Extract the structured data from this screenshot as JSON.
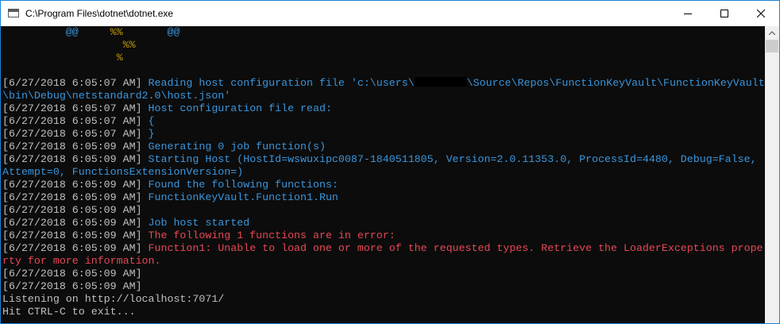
{
  "window": {
    "title": "C:\\Program Files\\dotnet\\dotnet.exe",
    "accent": "#1883d7"
  },
  "colors": {
    "background": "#0c0c0c",
    "default_text": "#c0c0c0",
    "info": "#3a96dd",
    "ascii_art": "#c19c00",
    "error": "#e74856"
  },
  "console": {
    "ascii": [
      {
        "left": "          ",
        "left_mark": "@@",
        "mid_gap": "     ",
        "mid_mark": "%%",
        "right_gap": "       ",
        "right_mark": "@@"
      },
      {
        "mid_pad": "                   ",
        "mid_mark": "%%"
      },
      {
        "mid_pad": "                  ",
        "mid_mark": "%"
      }
    ],
    "lines": [
      {
        "ts": "[6/27/2018 6:05:07 AM] ",
        "msg": "Reading host configuration file 'c:\\users\\",
        "msg_after": "\\Source\\Repos\\FunctionKeyVault\\FunctionKeyVault",
        "color": "cyan",
        "redacted": true
      },
      {
        "ts": "",
        "msg": "\\bin\\Debug\\netstandard2.0\\host.json'",
        "color": "cyan"
      },
      {
        "ts": "[6/27/2018 6:05:07 AM] ",
        "msg": "Host configuration file read:",
        "color": "cyan"
      },
      {
        "ts": "[6/27/2018 6:05:07 AM] ",
        "msg": "{",
        "color": "cyan"
      },
      {
        "ts": "[6/27/2018 6:05:07 AM] ",
        "msg": "}",
        "color": "cyan"
      },
      {
        "ts": "[6/27/2018 6:05:09 AM] ",
        "msg": "Generating 0 job function(s)",
        "color": "cyan"
      },
      {
        "ts": "[6/27/2018 6:05:09 AM] ",
        "msg": "Starting Host (HostId=wswuxipc0087-1840511805, Version=2.0.11353.0, ProcessId=4480, Debug=False,",
        "color": "cyan"
      },
      {
        "ts": "",
        "msg": "Attempt=0, FunctionsExtensionVersion=)",
        "color": "cyan"
      },
      {
        "ts": "[6/27/2018 6:05:09 AM] ",
        "msg": "Found the following functions:",
        "color": "cyan"
      },
      {
        "ts": "[6/27/2018 6:05:09 AM] ",
        "msg": "FunctionKeyVault.Function1.Run",
        "color": "cyan"
      },
      {
        "ts": "[6/27/2018 6:05:09 AM] ",
        "msg": "",
        "color": "cyan"
      },
      {
        "ts": "[6/27/2018 6:05:09 AM] ",
        "msg": "Job host started",
        "color": "cyan"
      },
      {
        "ts": "[6/27/2018 6:05:09 AM] ",
        "msg": "The following 1 functions are in error:",
        "color": "red"
      },
      {
        "ts": "[6/27/2018 6:05:09 AM] ",
        "msg": "Function1: Unable to load one or more of the requested types. Retrieve the LoaderExceptions prope",
        "color": "red"
      },
      {
        "ts": "",
        "msg": "rty for more information.",
        "color": "red"
      },
      {
        "ts": "[6/27/2018 6:05:09 AM] ",
        "msg": "",
        "color": "gray"
      },
      {
        "ts": "[6/27/2018 6:05:09 AM] ",
        "msg": "",
        "color": "gray"
      },
      {
        "ts": "",
        "msg": "Listening on http://localhost:7071/",
        "color": "gray"
      },
      {
        "ts": "",
        "msg": "Hit CTRL-C to exit...",
        "color": "gray"
      }
    ]
  },
  "icons": {
    "app": "console-app-icon",
    "minimize": "minimize-icon",
    "maximize": "maximize-icon",
    "close": "close-icon",
    "scroll_up": "chevron-up-icon"
  }
}
